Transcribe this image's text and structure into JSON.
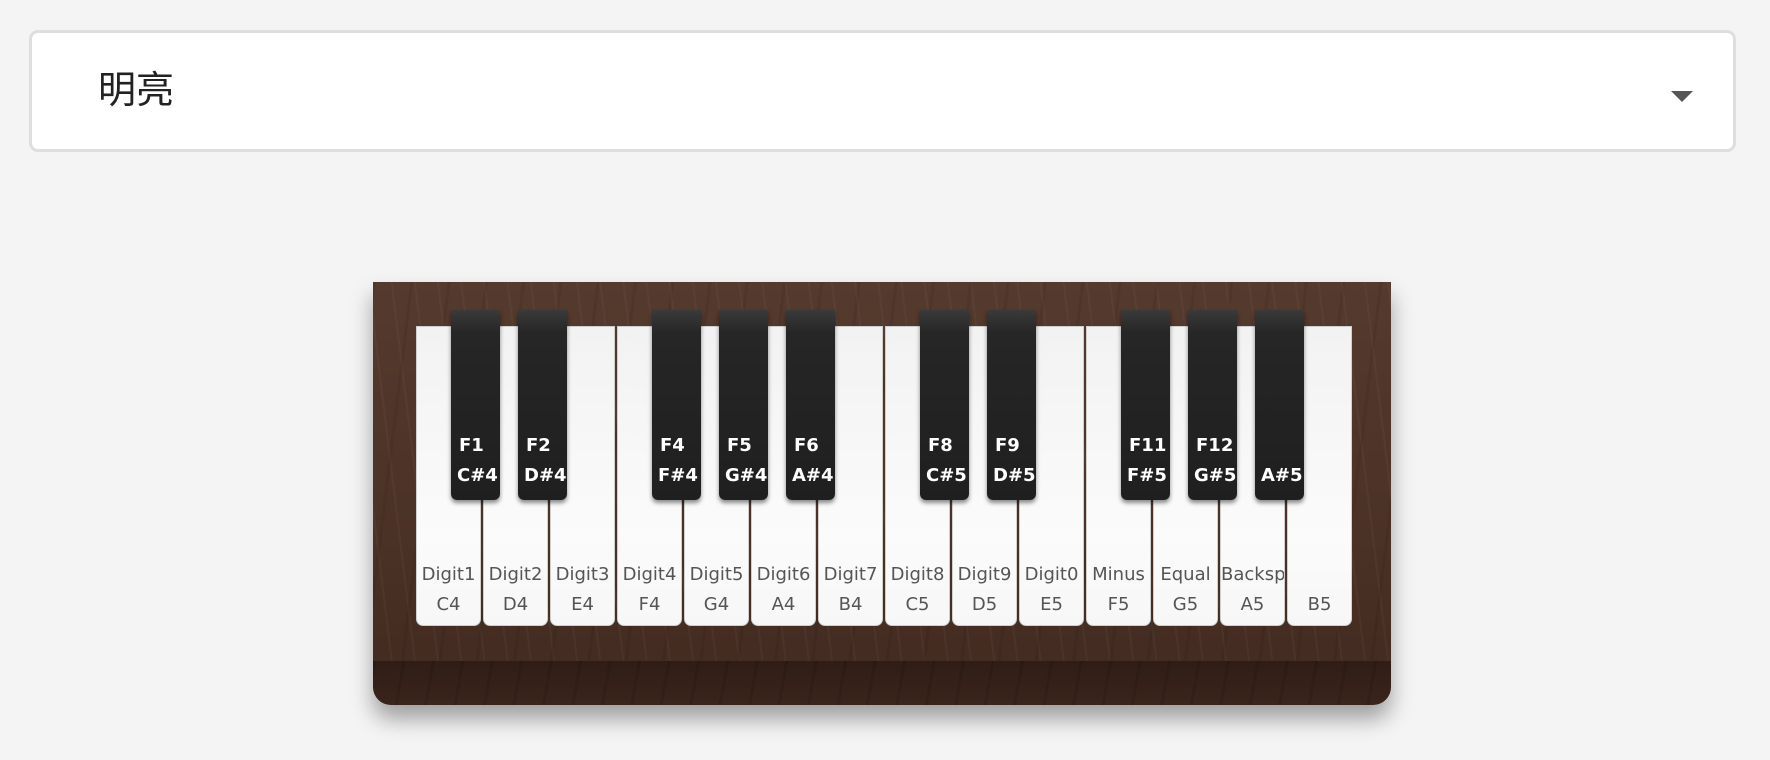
{
  "theme_select": {
    "value": "明亮",
    "caret_icon": "caret-down-icon"
  },
  "piano": {
    "white_keys": [
      {
        "keycode": "Digit1",
        "note": "C4"
      },
      {
        "keycode": "Digit2",
        "note": "D4"
      },
      {
        "keycode": "Digit3",
        "note": "E4"
      },
      {
        "keycode": "Digit4",
        "note": "F4"
      },
      {
        "keycode": "Digit5",
        "note": "G4"
      },
      {
        "keycode": "Digit6",
        "note": "A4"
      },
      {
        "keycode": "Digit7",
        "note": "B4"
      },
      {
        "keycode": "Digit8",
        "note": "C5"
      },
      {
        "keycode": "Digit9",
        "note": "D5"
      },
      {
        "keycode": "Digit0",
        "note": "E5"
      },
      {
        "keycode": "Minus",
        "note": "F5"
      },
      {
        "keycode": "Equal",
        "note": "G5"
      },
      {
        "keycode": "Backsp",
        "note": "A5"
      },
      {
        "keycode": "",
        "note": "B5"
      }
    ],
    "black_keys": [
      {
        "keycode": "F1",
        "note": "C#4"
      },
      {
        "keycode": "F2",
        "note": "D#4"
      },
      {
        "keycode": "F4",
        "note": "F#4"
      },
      {
        "keycode": "F5",
        "note": "G#4"
      },
      {
        "keycode": "F6",
        "note": "A#4"
      },
      {
        "keycode": "F8",
        "note": "C#5"
      },
      {
        "keycode": "F9",
        "note": "D#5"
      },
      {
        "keycode": "F11",
        "note": "F#5"
      },
      {
        "keycode": "F12",
        "note": "G#5"
      },
      {
        "keycode": "",
        "note": "A#5"
      }
    ]
  },
  "colors": {
    "page_background": "#f4f4f4",
    "piano_wood": "#4b3226",
    "white_key": "#f9f9f9",
    "black_key": "#222222"
  }
}
